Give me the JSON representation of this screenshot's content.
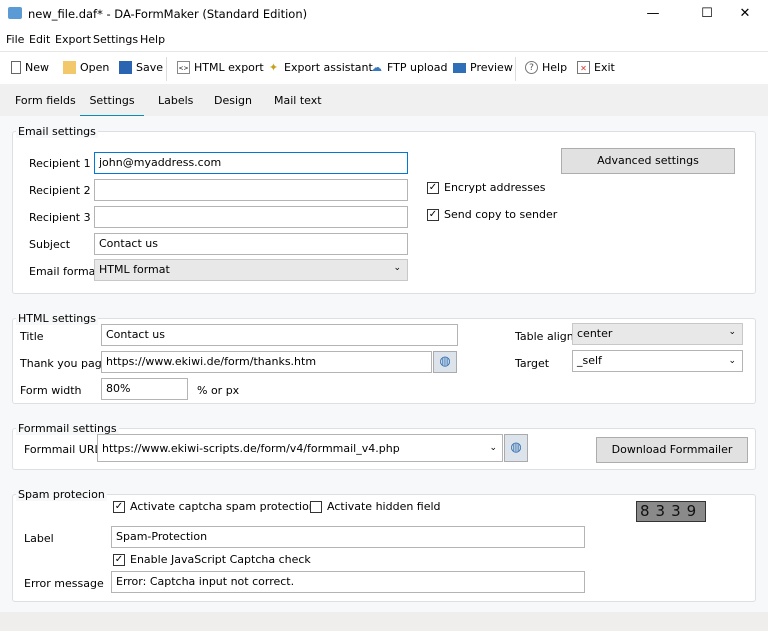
{
  "window": {
    "title": "new_file.daf* - DA-FormMaker (Standard Edition)",
    "minimize": "—",
    "maximize": "☐",
    "close": "✕"
  },
  "menu": [
    "File",
    "Edit",
    "Export",
    "Settings",
    "Help"
  ],
  "toolbar": [
    {
      "label": "New",
      "icon": "new-file-icon"
    },
    {
      "label": "Open",
      "icon": "folder-open-icon"
    },
    {
      "label": "Save",
      "icon": "save-icon"
    },
    {
      "label": "HTML export",
      "icon": "html-export-icon"
    },
    {
      "label": "Export assistant",
      "icon": "wand-icon"
    },
    {
      "label": "FTP upload",
      "icon": "cloud-upload-icon"
    },
    {
      "label": "Preview",
      "icon": "monitor-icon"
    },
    {
      "label": "Help",
      "icon": "help-icon"
    },
    {
      "label": "Exit",
      "icon": "exit-icon"
    }
  ],
  "tabs": [
    "Form fields",
    "Settings",
    "Labels",
    "Design",
    "Mail text"
  ],
  "active_tab": "Settings",
  "accent": "#0f8ab3",
  "email": {
    "legend": "Email settings",
    "recipient1_label": "Recipient 1",
    "recipient1": "john@myaddress.com",
    "recipient2_label": "Recipient 2",
    "recipient2": "",
    "recipient3_label": "Recipient 3",
    "recipient3": "",
    "subject_label": "Subject",
    "subject": "Contact us",
    "format_label": "Email format",
    "format": "HTML format",
    "advanced": "Advanced settings",
    "encrypt": "Encrypt addresses",
    "encrypt_checked": true,
    "copy": "Send copy to sender",
    "copy_checked": true
  },
  "html": {
    "legend": "HTML settings",
    "title_label": "Title",
    "title": "Contact us",
    "thanks_label": "Thank you page",
    "thanks": "https://www.ekiwi.de/form/thanks.htm",
    "width_label": "Form width",
    "width": "80%",
    "width_unit": "% or px",
    "align_label": "Table align",
    "align": "center",
    "target_label": "Target",
    "target": "_self"
  },
  "formmail": {
    "legend": "Formmail settings",
    "url_label": "Formmail URL",
    "url": "https://www.ekiwi-scripts.de/form/v4/formmail_v4.php",
    "download": "Download Formmailer"
  },
  "spam": {
    "legend": "Spam protecion",
    "captcha": "Activate captcha spam protection",
    "captcha_checked": true,
    "hidden": "Activate hidden field",
    "hidden_checked": false,
    "label_label": "Label",
    "label": "Spam-Protection",
    "js": "Enable JavaScript Captcha check",
    "js_checked": true,
    "error_label": "Error message",
    "error": "Error: Captcha input not correct.",
    "captcha_image": "8339"
  }
}
